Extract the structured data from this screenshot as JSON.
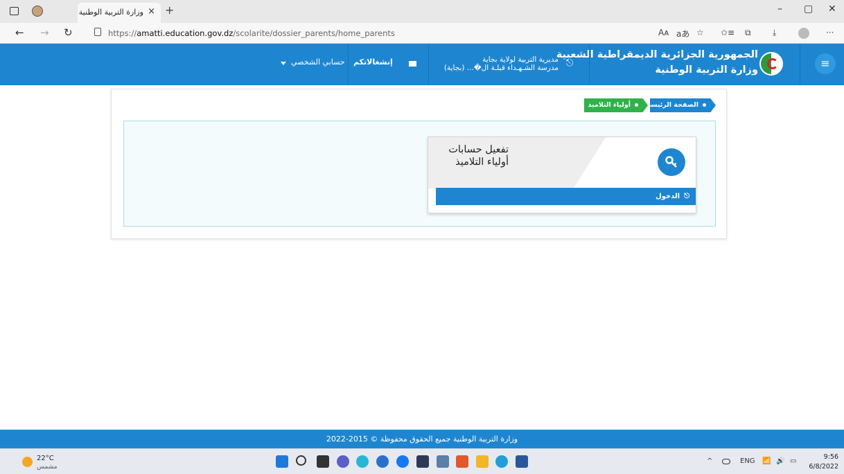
{
  "browser": {
    "tab_title": "وزارة التربية الوطنية",
    "tab_close": "×",
    "new_tab": "+",
    "window_controls": {
      "minimize": "–",
      "restore": "▢",
      "close": "✕"
    },
    "nav": {
      "back": "←",
      "forward": "→",
      "refresh": "↻"
    },
    "url_scheme": "https://",
    "url_host": "amatti.education.gov.dz",
    "url_path": "/scolarite/dossier_parents/home_parents",
    "toolbar_glyphs": {
      "read_aloud": "Aᴀ",
      "translate": "aあ",
      "favorite": "☆",
      "favorites": "✩≡",
      "collections": "⧉",
      "downloads": "⤓",
      "more": "···"
    }
  },
  "header": {
    "menu_glyph": "≡",
    "title_line1": "الجمهورية الجزائرية الديمقراطية الشعبية",
    "title_line2": "وزارة التربية الوطنية",
    "directorate_line1": "مديرية التربية لولاية بجاية",
    "directorate_line2": "مدرسة الشـهـداء قبلـة ال�... (بجاية)",
    "directorate_glyph": "⎋",
    "concerns": "إنشغالاتكم",
    "account": "حسابي الشخصي"
  },
  "breadcrumb": {
    "home": "الصفحة الرئيسة",
    "parents": "أولياء التلاميذ"
  },
  "tile": {
    "title_line1": "تفعيل حسابات",
    "title_line2": "أولياء التلاميذ",
    "login": "الدخول",
    "login_glyph": "⎋"
  },
  "footer": {
    "text": "وزارة التربية الوطنية جميع الحقوق محفوظة © 2015-2022"
  },
  "taskbar": {
    "weather_temp": "22°C",
    "weather_cond": "مشمس",
    "tray_caret": "^",
    "tray_lang": "ENG",
    "tray_wifi": "📶",
    "tray_sound": "🔊",
    "tray_battery": "▭",
    "time": "9:56",
    "date": "6/8/2022"
  },
  "colors": {
    "brand_blue": "#1e86d0",
    "crumb_green": "#2fb24a",
    "panel_border": "#a9dbe6"
  }
}
